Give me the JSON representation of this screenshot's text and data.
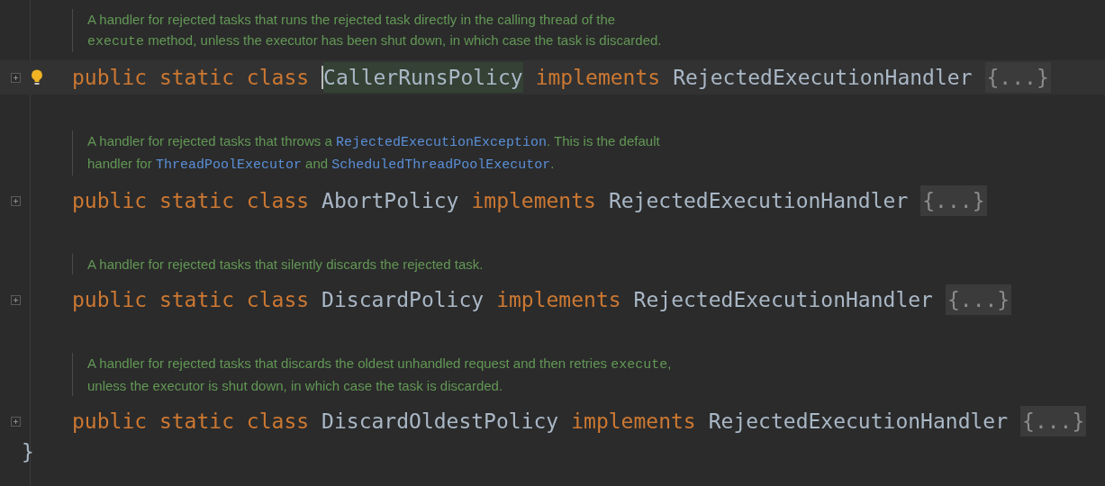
{
  "blocks": [
    {
      "doc": [
        [
          {
            "kind": "text",
            "text": "A handler for rejected tasks that runs the rejected task directly in the calling thread of the"
          }
        ],
        [
          {
            "kind": "code",
            "text": "execute"
          },
          {
            "kind": "text",
            "text": " method, unless the executor has been shut down, in which case the task is discarded."
          }
        ]
      ],
      "modifiers": "public static class",
      "name": "CallerRunsPolicy",
      "implements": "implements",
      "interface": "RejectedExecutionHandler",
      "fold": "{...}",
      "current_line": true,
      "name_highlighted": true,
      "intention_bulb": true
    },
    {
      "doc": [
        [
          {
            "kind": "text",
            "text": "A handler for rejected tasks that throws a "
          },
          {
            "kind": "link",
            "text": "RejectedExecutionException"
          },
          {
            "kind": "text",
            "text": ". This is the default"
          }
        ],
        [
          {
            "kind": "text",
            "text": "handler for "
          },
          {
            "kind": "link",
            "text": "ThreadPoolExecutor"
          },
          {
            "kind": "text",
            "text": " and "
          },
          {
            "kind": "link",
            "text": "ScheduledThreadPoolExecutor"
          },
          {
            "kind": "text",
            "text": "."
          }
        ]
      ],
      "modifiers": "public static class",
      "name": "AbortPolicy",
      "implements": "implements",
      "interface": "RejectedExecutionHandler",
      "fold": "{...}",
      "current_line": false,
      "name_highlighted": false,
      "intention_bulb": false
    },
    {
      "doc": [
        [
          {
            "kind": "text",
            "text": "A handler for rejected tasks that silently discards the rejected task."
          }
        ]
      ],
      "modifiers": "public static class",
      "name": "DiscardPolicy",
      "implements": "implements",
      "interface": "RejectedExecutionHandler",
      "fold": "{...}",
      "current_line": false,
      "name_highlighted": false,
      "intention_bulb": false
    },
    {
      "doc": [
        [
          {
            "kind": "text",
            "text": "A handler for rejected tasks that discards the oldest unhandled request and then retries "
          },
          {
            "kind": "code",
            "text": "execute"
          },
          {
            "kind": "text",
            "text": ","
          }
        ],
        [
          {
            "kind": "text",
            "text": "unless the executor is shut down, in which case the task is discarded."
          }
        ]
      ],
      "modifiers": "public static class",
      "name": "DiscardOldestPolicy",
      "implements": "implements",
      "interface": "RejectedExecutionHandler",
      "fold": "{...}",
      "current_line": false,
      "name_highlighted": false,
      "intention_bulb": false
    }
  ],
  "closing_brace": "}"
}
